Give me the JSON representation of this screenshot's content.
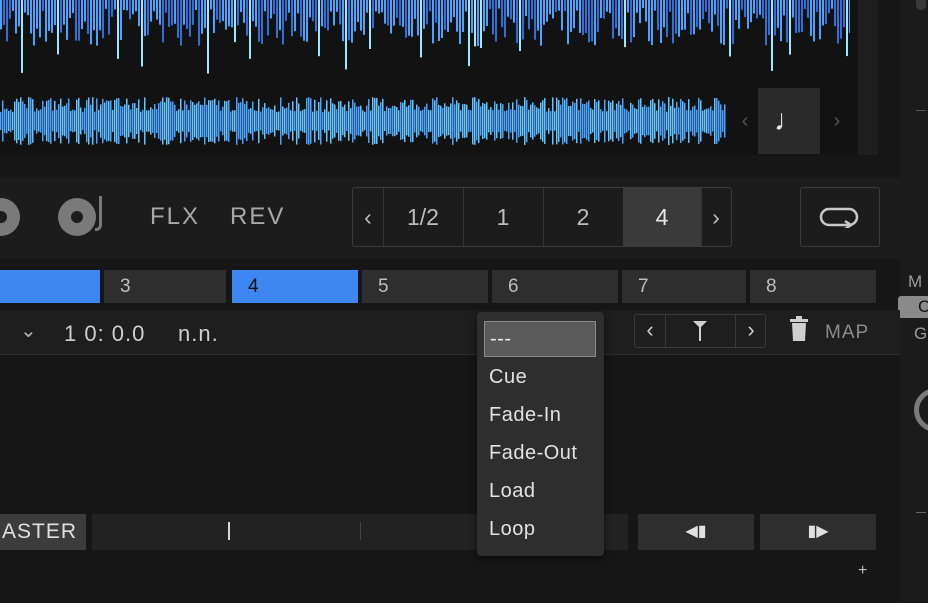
{
  "colors": {
    "accent_blue": "#3e86f0",
    "background": "#161616",
    "waveform": "#4aa3ff"
  },
  "waveform": {
    "overview_prev_label": "‹",
    "overview_next_label": "›",
    "note_icon": "♩"
  },
  "transport": {
    "flx_label": "FLX",
    "rev_label": "REV",
    "beatjump": {
      "prev_label": "‹",
      "next_label": "›",
      "sizes": [
        "1/2",
        "1",
        "2",
        "4"
      ],
      "selected": "4"
    }
  },
  "cue_slots": {
    "slot_3": "3",
    "slot_4": "4",
    "slot_5": "5",
    "slot_6": "6",
    "slot_7": "7",
    "slot_8": "8"
  },
  "cue_row": {
    "chevron": "⌄",
    "position": "1 0: 0.0",
    "name": "n.n.",
    "prev_label": "‹",
    "next_label": "›",
    "marker_icon": "Y",
    "map_label": "MAP"
  },
  "dropdown": {
    "items": [
      "---",
      "Cue",
      "Fade-In",
      "Fade-Out",
      "Load",
      "Loop"
    ],
    "selected": "---"
  },
  "right_panel": {
    "m_label": "M",
    "c_label": "C",
    "g_label": "G"
  },
  "bottom": {
    "master_label": "ASTER",
    "nudge_back_label": "◀▮",
    "nudge_forward_label": "▮▶",
    "add_label": "+"
  }
}
